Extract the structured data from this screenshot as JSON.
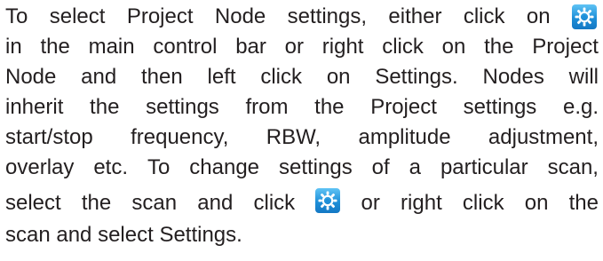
{
  "paragraph": {
    "line1": [
      "To",
      "select",
      "Project",
      "Node",
      "settings,",
      "either",
      "click",
      "on"
    ],
    "line2": [
      "in",
      "the",
      "main",
      "control",
      "bar",
      "or",
      "right",
      "click",
      "on",
      "the",
      "Project"
    ],
    "line3": [
      "Node",
      "and",
      "then",
      "left",
      "click",
      "on",
      "Settings.",
      "Nodes",
      "will"
    ],
    "line4": [
      "inherit",
      "the",
      "settings",
      "from",
      "the",
      "Project",
      "settings",
      "e.g."
    ],
    "line5": [
      "start/stop",
      "frequency,",
      "RBW,",
      "amplitude",
      "adjustment,"
    ],
    "line6": [
      "overlay",
      "etc.",
      "To",
      "change",
      "settings",
      "of",
      "a",
      "particular",
      "scan,"
    ],
    "line7a": [
      "select",
      "the",
      "scan",
      "and",
      "click"
    ],
    "line7b": [
      "or",
      "right",
      "click",
      "on",
      "the"
    ],
    "line8": "scan and select Settings."
  },
  "icons": {
    "settings_icon_1": "gear-icon",
    "settings_icon_2": "gear-icon",
    "icon_color": "#1e8fd8"
  }
}
